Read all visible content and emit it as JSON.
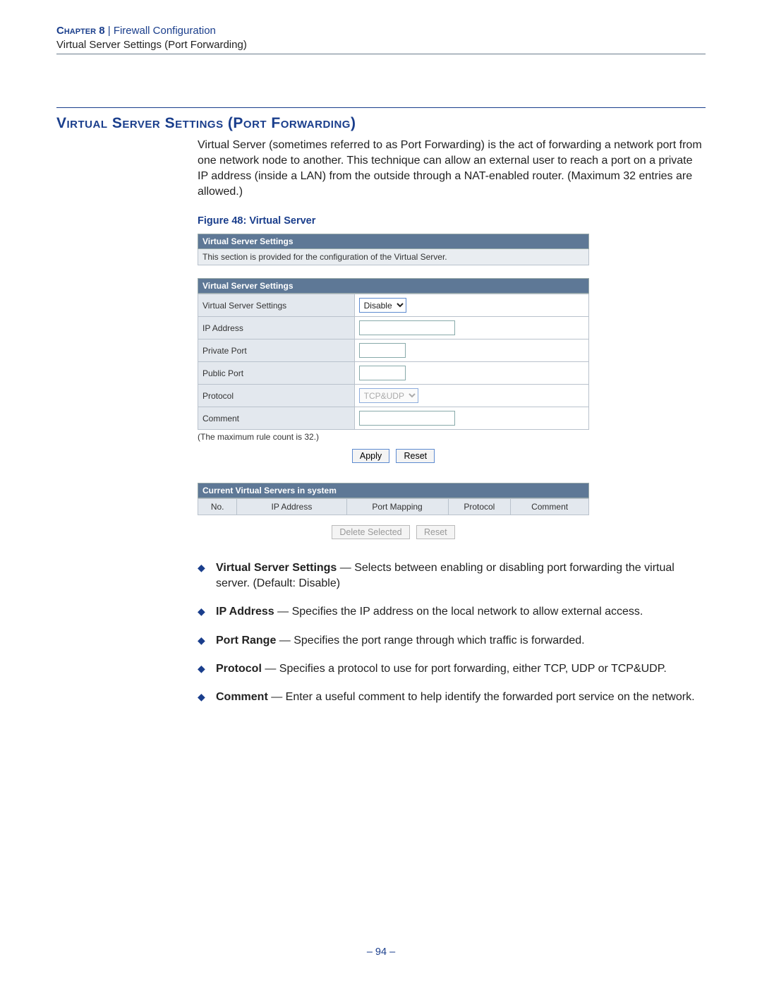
{
  "header": {
    "chapter_label": "Chapter 8",
    "separator": "  |  ",
    "chapter_title": "Firewall Configuration",
    "subtitle": "Virtual Server Settings (Port Forwarding)"
  },
  "section": {
    "title": "Virtual Server Settings (Port Forwarding)",
    "intro": "Virtual Server (sometimes referred to as Port Forwarding) is the act of forwarding a network port from one network node to another. This technique can allow an external user to reach a port on a private IP address (inside a LAN) from the outside through a NAT-enabled router. (Maximum 32 entries are allowed.)"
  },
  "figure": {
    "caption": "Figure 48:  Virtual Server",
    "panel1_title": "Virtual Server Settings",
    "panel1_desc": "This section is provided for the configuration of the Virtual Server.",
    "panel2_title": "Virtual Server Settings",
    "rows": {
      "r0_label": "Virtual Server Settings",
      "r0_value": "Disable",
      "r1_label": "IP Address",
      "r2_label": "Private Port",
      "r3_label": "Public Port",
      "r4_label": "Protocol",
      "r4_value": "TCP&UDP",
      "r5_label": "Comment"
    },
    "note": "(The maximum rule count is 32.)",
    "buttons": {
      "apply": "Apply",
      "reset": "Reset"
    },
    "panel3_title": "Current Virtual Servers in system",
    "cols": {
      "no": "No.",
      "ip": "IP Address",
      "pm": "Port Mapping",
      "proto": "Protocol",
      "comment": "Comment"
    },
    "buttons2": {
      "delete": "Delete Selected",
      "reset": "Reset"
    }
  },
  "bullets": [
    {
      "term": "Virtual Server Settings",
      "text": " — Selects between enabling or disabling port forwarding the virtual server. (Default: Disable)"
    },
    {
      "term": "IP Address",
      "text": " — Specifies the IP address on the local network to allow external access."
    },
    {
      "term": "Port Range",
      "text": " — Specifies the port range through which traffic is forwarded."
    },
    {
      "term": "Protocol",
      "text": " — Specifies a protocol to use for port forwarding, either TCP, UDP or TCP&UDP."
    },
    {
      "term": "Comment",
      "text": " — Enter a useful comment to help identify the forwarded port service on the network."
    }
  ],
  "page_number": "–  94  –"
}
